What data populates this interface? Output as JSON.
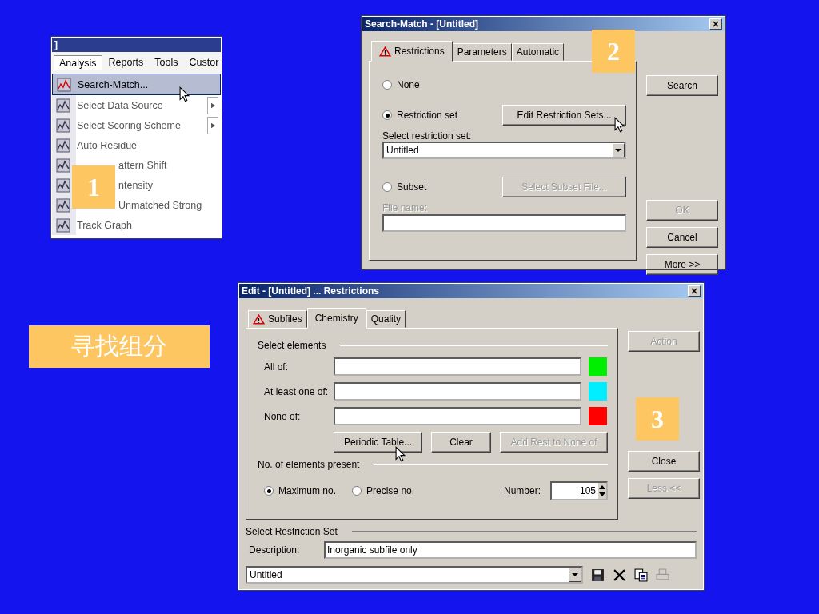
{
  "slide_label": "寻找组分",
  "menu_window": {
    "title": "]",
    "badge": "1",
    "menubar": [
      {
        "label": "Analysis",
        "selected": true
      },
      {
        "label": "Reports",
        "selected": false
      },
      {
        "label": "Tools",
        "selected": false
      },
      {
        "label": "Custor",
        "selected": false
      }
    ],
    "items": [
      {
        "label": "Search-Match...",
        "selected": true,
        "submenu": false,
        "covered": false
      },
      {
        "label": "Select Data Source",
        "selected": false,
        "submenu": true,
        "covered": false
      },
      {
        "label": "Select Scoring Scheme",
        "selected": false,
        "submenu": true,
        "covered": false
      },
      {
        "label": "Auto Residue",
        "selected": false,
        "submenu": false,
        "covered": false
      },
      {
        "label": "attern Shift",
        "selected": false,
        "submenu": false,
        "covered": true
      },
      {
        "label": "ntensity",
        "selected": false,
        "submenu": false,
        "covered": true
      },
      {
        "label": "Unmatched Strong",
        "selected": false,
        "submenu": false,
        "covered": true
      },
      {
        "label": "Track Graph",
        "selected": false,
        "submenu": false,
        "covered": false
      }
    ]
  },
  "search_dialog": {
    "title": "Search-Match - [Untitled]",
    "badge": "2",
    "tabs": [
      {
        "label": "Restrictions",
        "warning": true,
        "selected": true
      },
      {
        "label": "Parameters",
        "warning": false,
        "selected": false
      },
      {
        "label": "Automatic",
        "warning": false,
        "selected": false
      }
    ],
    "radio_none": {
      "label": "None",
      "selected": false
    },
    "radio_set": {
      "label": "Restriction set",
      "selected": true
    },
    "edit_button": {
      "label": "Edit Restriction Sets...",
      "disabled": false
    },
    "set_label": "Select restriction set:",
    "set_value": "Untitled",
    "radio_subset": {
      "label": "Subset",
      "selected": false
    },
    "subset_button": {
      "label": "Select Subset File...",
      "disabled": true
    },
    "file_label": "File name:",
    "buttons": [
      {
        "label": "Search",
        "disabled": false
      },
      {
        "label": "OK",
        "disabled": true
      },
      {
        "label": "Cancel",
        "disabled": false
      },
      {
        "label": "More >>",
        "disabled": false
      }
    ]
  },
  "edit_dialog": {
    "title": "Edit - [Untitled] ... Restrictions",
    "badge": "3",
    "tabs": [
      {
        "label": "Subfiles",
        "warning": true,
        "selected": false
      },
      {
        "label": "Chemistry",
        "warning": false,
        "selected": true
      },
      {
        "label": "Quality",
        "warning": false,
        "selected": false
      }
    ],
    "elements_header": "Select elements",
    "element_rows": [
      {
        "label": "All of:",
        "color": "#00ee00"
      },
      {
        "label": "At least one of:",
        "color": "#00eeff"
      },
      {
        "label": "None of:",
        "color": "#ff0000"
      }
    ],
    "element_buttons": [
      {
        "label": "Periodic Table...",
        "disabled": false
      },
      {
        "label": "Clear",
        "disabled": false
      },
      {
        "label": "Add Rest to None of",
        "disabled": true
      }
    ],
    "count_header": "No. of elements present",
    "count_options": [
      {
        "label": "Maximum no.",
        "selected": true
      },
      {
        "label": "Precise no.",
        "selected": false
      }
    ],
    "number_label": "Number:",
    "number_value": "105",
    "side_buttons": [
      {
        "label": "Action",
        "disabled": true
      },
      {
        "label": "Close",
        "disabled": false
      },
      {
        "label": "Less <<",
        "disabled": true
      }
    ],
    "set_header": "Select Restriction Set",
    "description_label": "Description:",
    "description_value": "Inorganic subfile only",
    "set_value": "Untitled"
  }
}
